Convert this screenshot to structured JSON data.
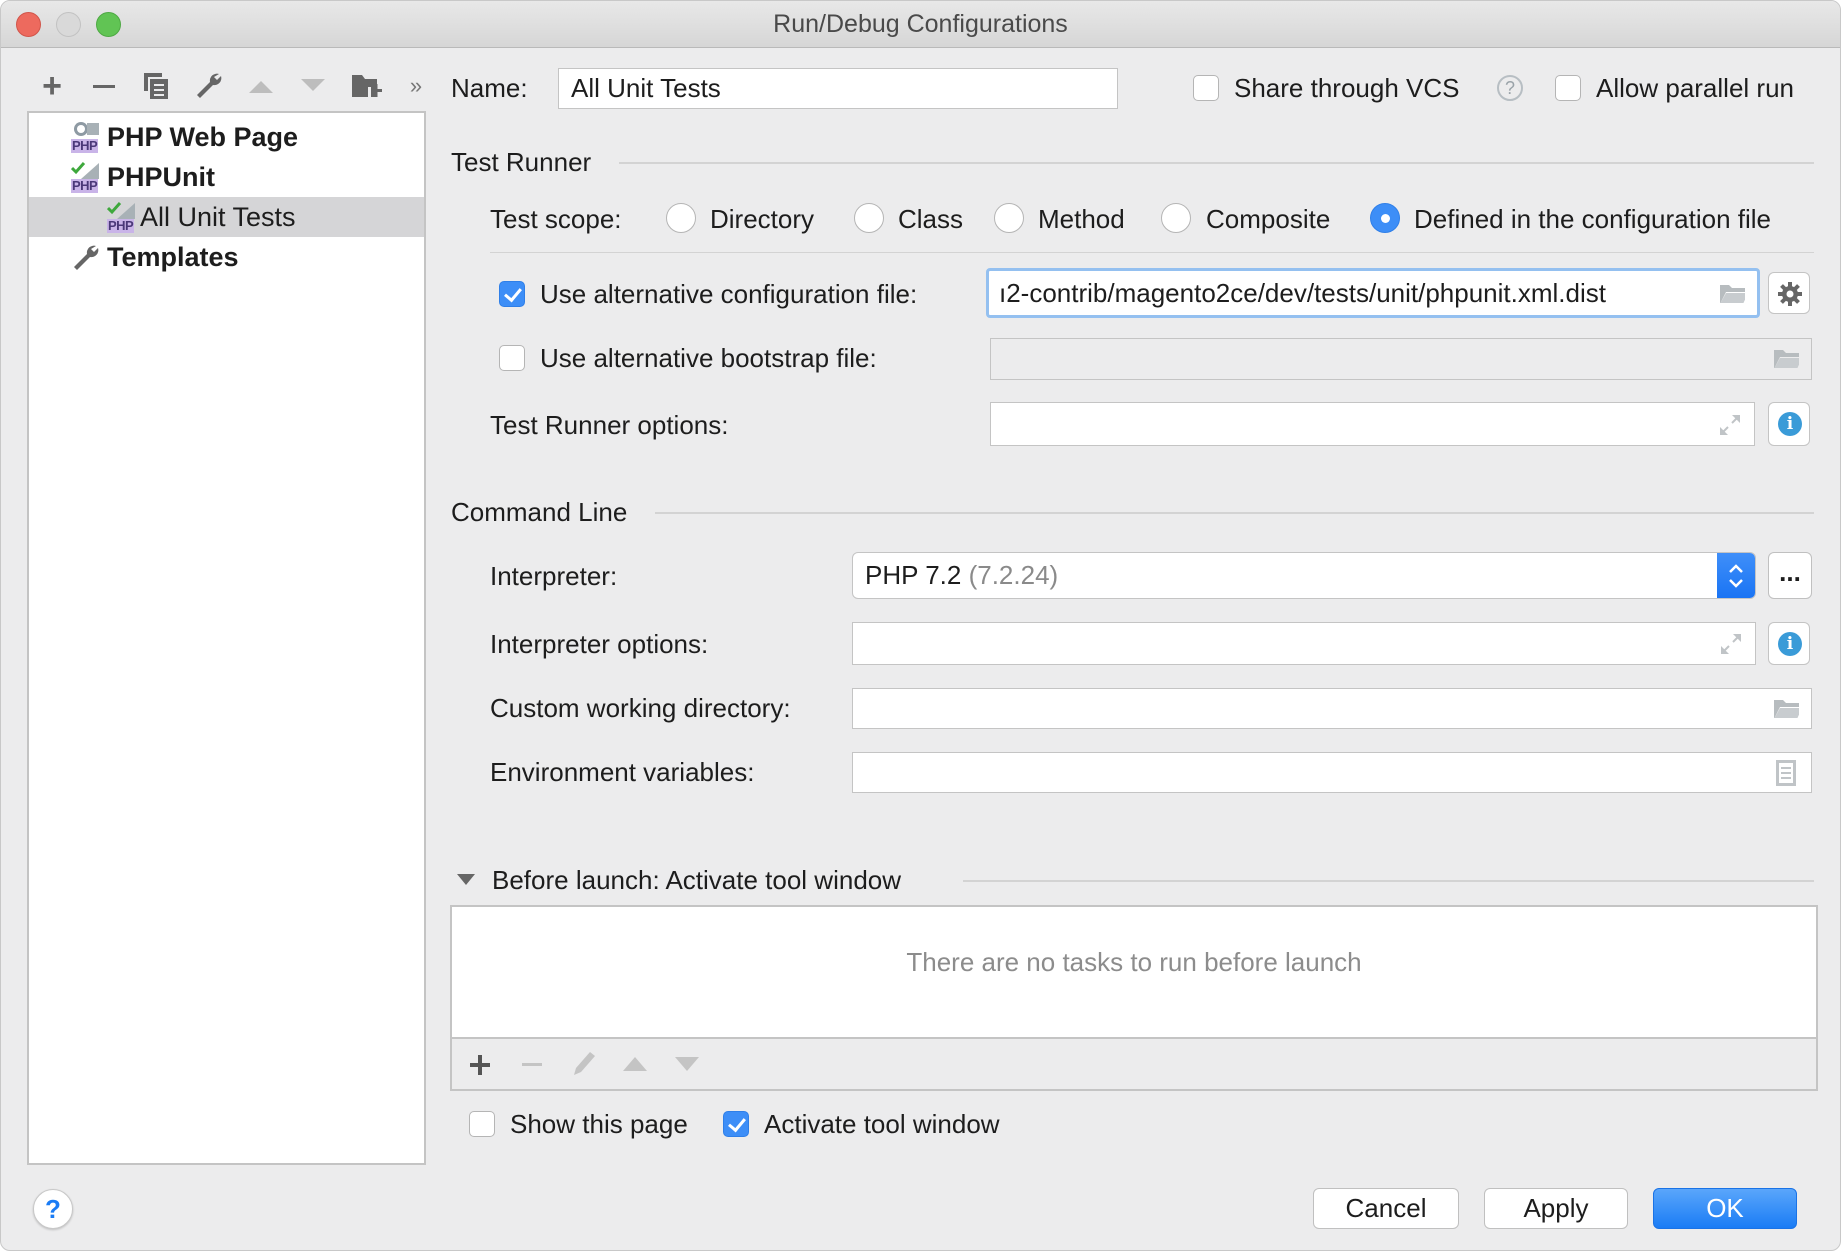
{
  "window": {
    "title": "Run/Debug Configurations"
  },
  "toolbar": {
    "icons": [
      "add-icon",
      "remove-icon",
      "copy-icon",
      "wrench-icon",
      "move-up-icon",
      "move-down-icon",
      "new-folder-icon",
      "more-icon"
    ],
    "more_glyph": "»"
  },
  "tree": {
    "items": [
      {
        "label": "PHP Web Page",
        "expanded": false,
        "bold": true
      },
      {
        "label": "PHPUnit",
        "expanded": true,
        "bold": true
      },
      {
        "label": "All Unit Tests",
        "selected": true,
        "bold": false
      },
      {
        "label": "Templates",
        "expanded": false,
        "bold": true
      }
    ],
    "php_badge": "PHP"
  },
  "header": {
    "name_label": "Name:",
    "name_value": "All Unit Tests",
    "share_vcs_label": "Share through VCS",
    "share_vcs_checked": false,
    "help_glyph": "?",
    "parallel_label": "Allow parallel run",
    "parallel_checked": false
  },
  "test_runner": {
    "section_title": "Test Runner",
    "scope_label": "Test scope:",
    "scopes": [
      {
        "label": "Directory",
        "selected": false
      },
      {
        "label": "Class",
        "selected": false
      },
      {
        "label": "Method",
        "selected": false
      },
      {
        "label": "Composite",
        "selected": false
      },
      {
        "label": "Defined in the configuration file",
        "selected": true
      }
    ],
    "alt_config_label": "Use alternative configuration file:",
    "alt_config_checked": true,
    "alt_config_value": "ı2-contrib/magento2ce/dev/tests/unit/phpunit.xml.dist",
    "alt_bootstrap_label": "Use alternative bootstrap file:",
    "alt_bootstrap_checked": false,
    "alt_bootstrap_value": "",
    "runner_options_label": "Test Runner options:",
    "runner_options_value": ""
  },
  "command_line": {
    "section_title": "Command Line",
    "interpreter_label": "Interpreter:",
    "interpreter_value": "PHP 7.2",
    "interpreter_version": "(7.2.24)",
    "ellipsis_label": "...",
    "interpreter_options_label": "Interpreter options:",
    "interpreter_options_value": "",
    "working_dir_label": "Custom working directory:",
    "working_dir_value": "",
    "env_vars_label": "Environment variables:",
    "env_vars_value": ""
  },
  "before_launch": {
    "title": "Before launch: Activate tool window",
    "empty_text": "There are no tasks to run before launch",
    "show_page_label": "Show this page",
    "show_page_checked": false,
    "activate_label": "Activate tool window",
    "activate_checked": true
  },
  "footer": {
    "help_glyph": "?",
    "cancel_label": "Cancel",
    "apply_label": "Apply",
    "ok_label": "OK"
  },
  "colors": {
    "accent": "#3d8ef7",
    "info": "#3a9bd8",
    "selection": "#d5d5d7"
  }
}
